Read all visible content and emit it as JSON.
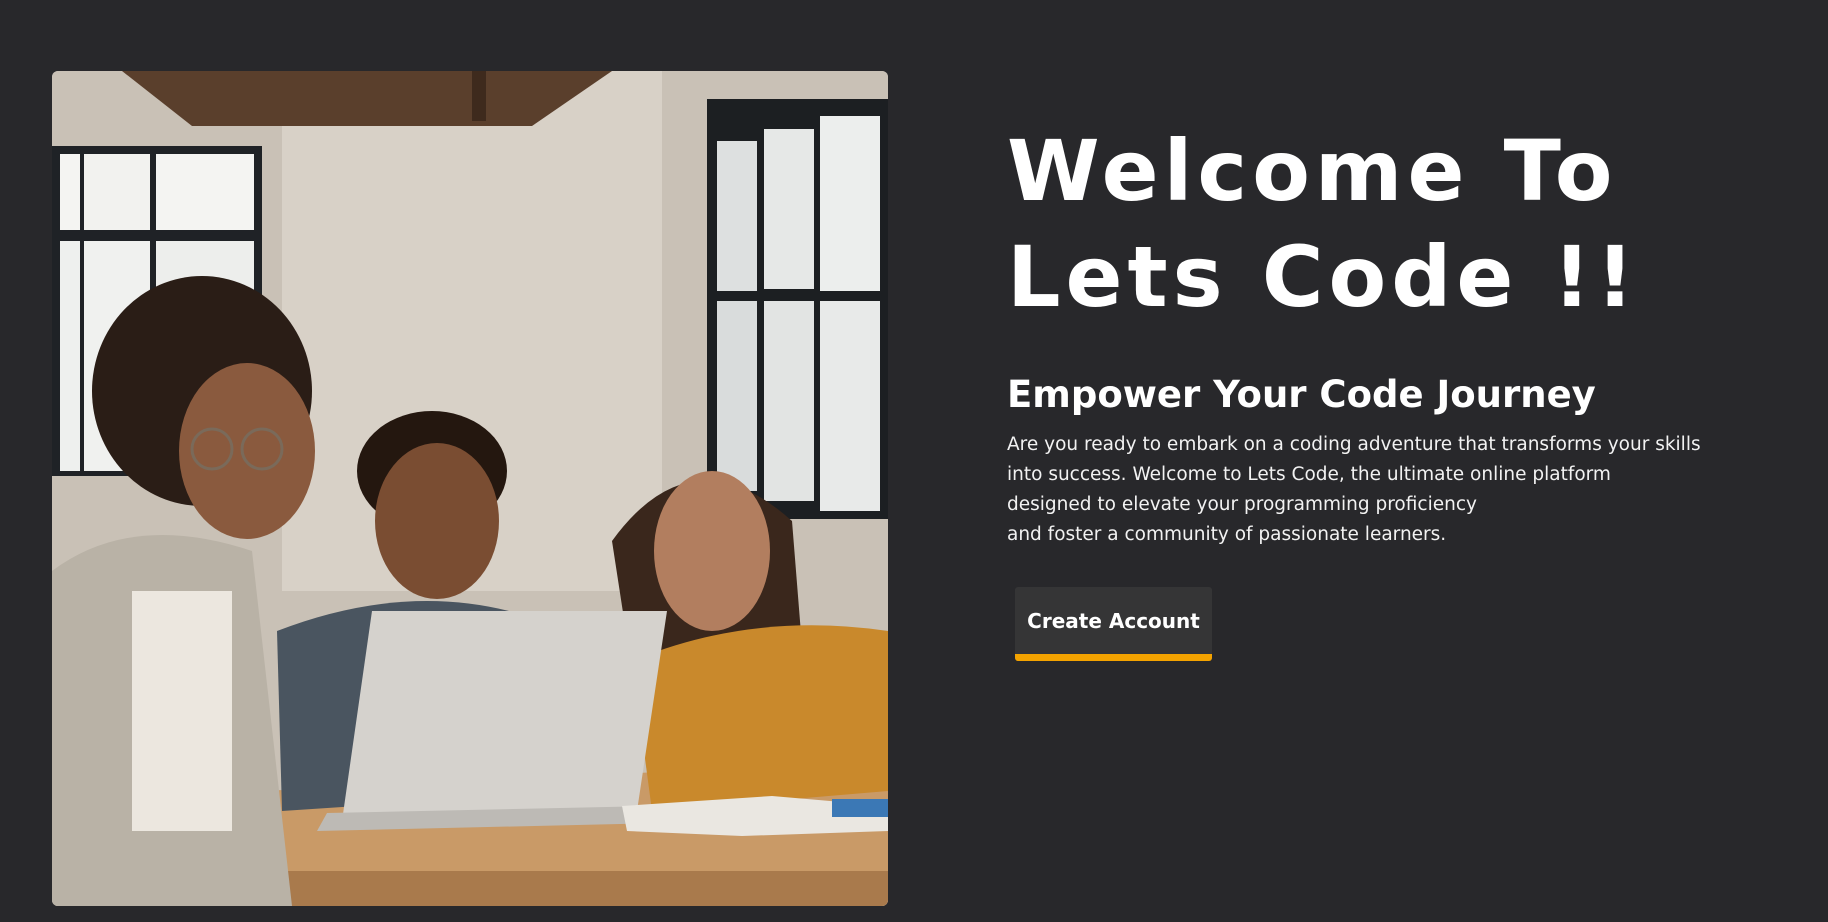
{
  "hero": {
    "title_line1": "Welcome To",
    "title_line2": "Lets Code !!",
    "subtitle": "Empower Your Code Journey",
    "description_lines": [
      "Are you ready to embark on a coding adventure that transforms your skills",
      "into success. Welcome to Lets Code, the ultimate online platform",
      "designed to elevate your programming proficiency",
      "and foster a community of passionate learners."
    ],
    "cta_label": "Create Account"
  },
  "image": {
    "subject": "three-students-laptop-photo"
  },
  "colors": {
    "background": "#28282b",
    "text": "#ffffff",
    "button_background": "#353536",
    "button_accent": "#f4a300"
  }
}
